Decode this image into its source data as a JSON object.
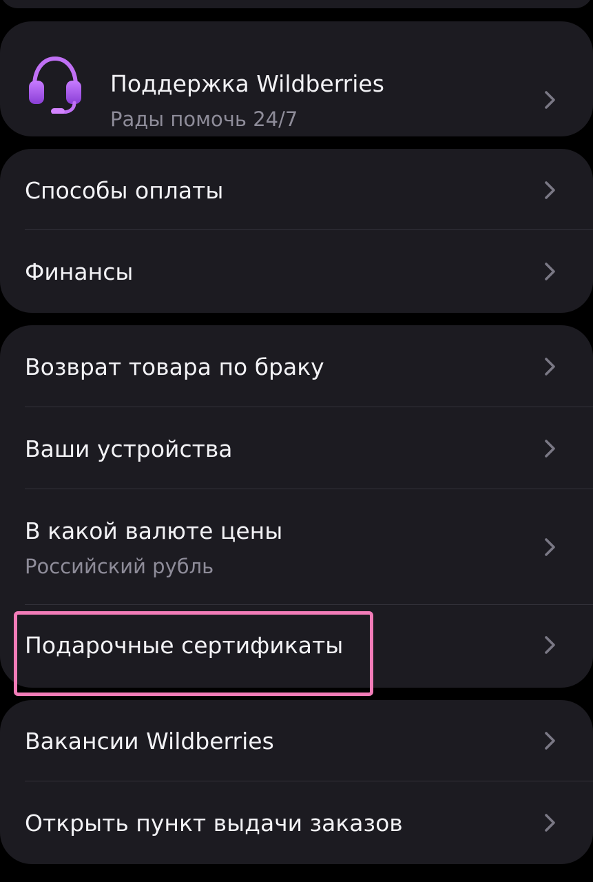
{
  "support": {
    "title": "Поддержка Wildberries",
    "subtitle": "Рады помочь 24/7",
    "icon": "headset-icon"
  },
  "group_finance": [
    {
      "label": "Способы оплаты"
    },
    {
      "label": "Финансы"
    }
  ],
  "group_settings": [
    {
      "label": "Возврат товара по браку"
    },
    {
      "label": "Ваши устройства"
    },
    {
      "label": "В какой валюте цены",
      "sub": "Российский рубль"
    },
    {
      "label": "Подарочные сертификаты"
    }
  ],
  "group_misc": [
    {
      "label": "Вакансии Wildberries"
    },
    {
      "label": "Открыть пункт выдачи заказов"
    }
  ],
  "colors": {
    "background": "#000000",
    "card": "#1c1b21",
    "text": "#f2f2f5",
    "secondary_text": "#8e8c99",
    "accent_purple": "#b45cf0",
    "highlight": "#f27cb8"
  }
}
